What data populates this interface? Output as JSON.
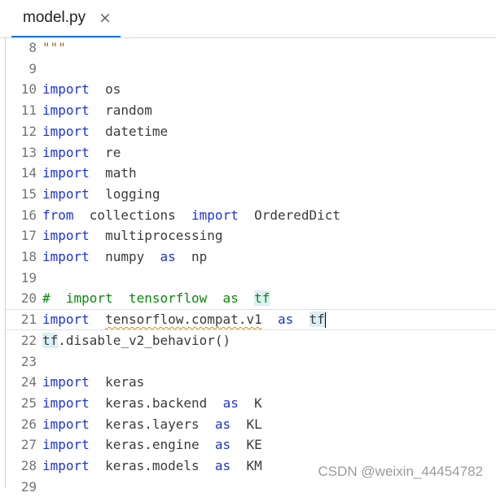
{
  "tab": {
    "label": "model.py",
    "close_glyph": "×"
  },
  "lines": [
    {
      "n": "8",
      "segs": [
        {
          "t": "\"\"\"",
          "c": "docstr"
        }
      ]
    },
    {
      "n": "9",
      "segs": []
    },
    {
      "n": "10",
      "segs": [
        {
          "t": "import",
          "c": "kw"
        },
        {
          "t": "  os"
        }
      ]
    },
    {
      "n": "11",
      "segs": [
        {
          "t": "import",
          "c": "kw"
        },
        {
          "t": "  random"
        }
      ]
    },
    {
      "n": "12",
      "segs": [
        {
          "t": "import",
          "c": "kw"
        },
        {
          "t": "  datetime"
        }
      ]
    },
    {
      "n": "13",
      "segs": [
        {
          "t": "import",
          "c": "kw"
        },
        {
          "t": "  re"
        }
      ]
    },
    {
      "n": "14",
      "segs": [
        {
          "t": "import",
          "c": "kw"
        },
        {
          "t": "  math"
        }
      ]
    },
    {
      "n": "15",
      "segs": [
        {
          "t": "import",
          "c": "kw"
        },
        {
          "t": "  logging"
        }
      ]
    },
    {
      "n": "16",
      "segs": [
        {
          "t": "from",
          "c": "kw"
        },
        {
          "t": "  collections  "
        },
        {
          "t": "import",
          "c": "kw"
        },
        {
          "t": "  OrderedDict"
        }
      ]
    },
    {
      "n": "17",
      "segs": [
        {
          "t": "import",
          "c": "kw"
        },
        {
          "t": "  multiprocessing"
        }
      ]
    },
    {
      "n": "18",
      "segs": [
        {
          "t": "import",
          "c": "kw"
        },
        {
          "t": "  numpy  "
        },
        {
          "t": "as",
          "c": "kw"
        },
        {
          "t": "  np"
        }
      ]
    },
    {
      "n": "19",
      "segs": []
    },
    {
      "n": "20",
      "segs": [
        {
          "t": "#  import  tensorflow  as  ",
          "c": "cm"
        },
        {
          "t": "tf",
          "c": "cm hl"
        }
      ]
    },
    {
      "n": "21",
      "current": true,
      "segs": [
        {
          "t": "import",
          "c": "kw"
        },
        {
          "t": "  "
        },
        {
          "t": "tensorflow.compat.v1",
          "c": "squig"
        },
        {
          "t": "  "
        },
        {
          "t": "as",
          "c": "kw"
        },
        {
          "t": "  "
        },
        {
          "t": "tf",
          "c": "hl"
        },
        {
          "caret": true
        }
      ]
    },
    {
      "n": "22",
      "segs": [
        {
          "t": "tf",
          "c": "hl"
        },
        {
          "t": ".disable_v2_behavior()"
        }
      ]
    },
    {
      "n": "23",
      "segs": []
    },
    {
      "n": "24",
      "segs": [
        {
          "t": "import",
          "c": "kw"
        },
        {
          "t": "  keras"
        }
      ]
    },
    {
      "n": "25",
      "segs": [
        {
          "t": "import",
          "c": "kw"
        },
        {
          "t": "  keras.backend  "
        },
        {
          "t": "as",
          "c": "kw"
        },
        {
          "t": "  K"
        }
      ]
    },
    {
      "n": "26",
      "segs": [
        {
          "t": "import",
          "c": "kw"
        },
        {
          "t": "  keras.layers  "
        },
        {
          "t": "as",
          "c": "kw"
        },
        {
          "t": "  KL"
        }
      ]
    },
    {
      "n": "27",
      "segs": [
        {
          "t": "import",
          "c": "kw"
        },
        {
          "t": "  keras.engine  "
        },
        {
          "t": "as",
          "c": "kw"
        },
        {
          "t": "  KE"
        }
      ]
    },
    {
      "n": "28",
      "segs": [
        {
          "t": "import",
          "c": "kw"
        },
        {
          "t": "  keras.models  "
        },
        {
          "t": "as",
          "c": "kw"
        },
        {
          "t": "  KM"
        }
      ]
    },
    {
      "n": "29",
      "segs": []
    }
  ],
  "watermark": "CSDN @weixin_44454782",
  "colors": {
    "keyword": "#1d34d6",
    "comment": "#0a8a0a",
    "tab_underline": "#1a73e8",
    "highlight": "#dbeff5"
  }
}
